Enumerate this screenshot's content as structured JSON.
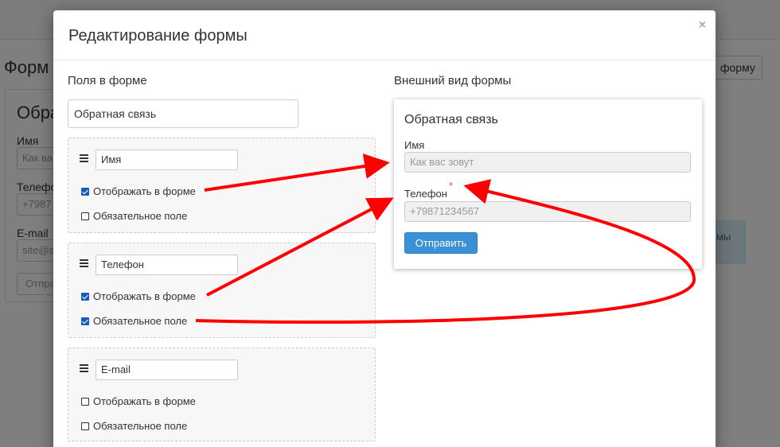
{
  "background": {
    "page_title": "Форм",
    "right_button_label": "форму",
    "card_title": "Обра",
    "fields": [
      {
        "label": "Имя",
        "placeholder": "Как ва"
      },
      {
        "label": "Телефо",
        "placeholder": "+7987"
      },
      {
        "label": "E-mail",
        "placeholder": "site@s"
      }
    ],
    "submit_label": "Отпра",
    "right_box_text": "мы"
  },
  "modal": {
    "title": "Редактирование формы",
    "close_label": "×",
    "left_heading": "Поля в форме",
    "right_heading": "Внешний вид формы",
    "form_name": "Обратная связь",
    "fields": [
      {
        "name": "Имя",
        "show_label": "Отображать в форме",
        "show_checked": true,
        "required_label": "Обязательное поле",
        "required_checked": false
      },
      {
        "name": "Телефон",
        "show_label": "Отображать в форме",
        "show_checked": true,
        "required_label": "Обязательное поле",
        "required_checked": true
      },
      {
        "name": "E-mail",
        "show_label": "Отображать в форме",
        "show_checked": false,
        "required_label": "Обязательное поле",
        "required_checked": false
      }
    ]
  },
  "preview": {
    "title": "Обратная связь",
    "fields": [
      {
        "label": "Имя",
        "placeholder": "Как вас зовут",
        "required": false
      },
      {
        "label": "Телефон",
        "placeholder": "+79871234567",
        "required": true
      }
    ],
    "required_marker": "*",
    "submit_label": "Отправить"
  },
  "colors": {
    "arrow": "#ff0000",
    "accent": "#3a91d6",
    "checkbox": "#1a5bb8",
    "required": "#d9534f"
  }
}
